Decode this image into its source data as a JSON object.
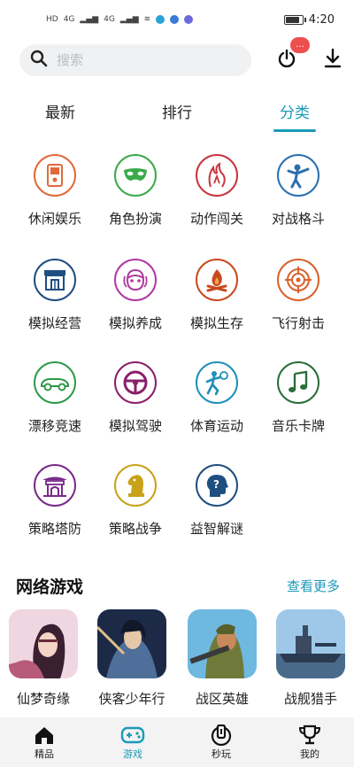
{
  "status": {
    "sim_labels": [
      "HD",
      "4G",
      "4G"
    ],
    "time": "4:20",
    "battery_level": 0.9
  },
  "search": {
    "placeholder": "搜索",
    "badge_text": "..."
  },
  "tabs": [
    {
      "label": "最新",
      "active": false
    },
    {
      "label": "排行",
      "active": false
    },
    {
      "label": "分类",
      "active": true
    }
  ],
  "categories": [
    {
      "label": "休闲娱乐",
      "icon": "handheld-console-icon",
      "color": "#e06a3a"
    },
    {
      "label": "角色扮演",
      "icon": "mask-icon",
      "color": "#3aaa4a"
    },
    {
      "label": "动作闯关",
      "icon": "flame-figure-icon",
      "color": "#c93540"
    },
    {
      "label": "对战格斗",
      "icon": "kick-fighter-icon",
      "color": "#2b6fb0"
    },
    {
      "label": "模拟经营",
      "icon": "storefront-icon",
      "color": "#1f4f80"
    },
    {
      "label": "模拟养成",
      "icon": "anime-girl-icon",
      "color": "#b03aa0"
    },
    {
      "label": "模拟生存",
      "icon": "campfire-icon",
      "color": "#c84a1f"
    },
    {
      "label": "飞行射击",
      "icon": "crosshair-target-icon",
      "color": "#d9622a"
    },
    {
      "label": "漂移竞速",
      "icon": "race-car-icon",
      "color": "#2e9a4a"
    },
    {
      "label": "模拟驾驶",
      "icon": "steering-wheel-icon",
      "color": "#8a1f6a"
    },
    {
      "label": "体育运动",
      "icon": "tennis-player-icon",
      "color": "#1e8fb8"
    },
    {
      "label": "音乐卡牌",
      "icon": "music-note-icon",
      "color": "#2a6e3a"
    },
    {
      "label": "策略塔防",
      "icon": "temple-icon",
      "color": "#7a2a8a"
    },
    {
      "label": "策略战争",
      "icon": "chess-knight-icon",
      "color": "#c9a21a"
    },
    {
      "label": "益智解谜",
      "icon": "puzzle-head-icon",
      "color": "#1f4f80"
    }
  ],
  "online_section": {
    "title": "网络游戏",
    "more": "查看更多"
  },
  "games": [
    {
      "name": "仙梦奇缘",
      "colors": [
        "#f0d6e0",
        "#b85a7a",
        "#3a2030"
      ]
    },
    {
      "name": "侠客少年行",
      "colors": [
        "#1c2a48",
        "#4f6f9a",
        "#e0c08a"
      ]
    },
    {
      "name": "战区英雄",
      "colors": [
        "#6fb8e0",
        "#6f7a3a",
        "#c88a5a"
      ]
    },
    {
      "name": "战舰猎手",
      "colors": [
        "#9fc8e8",
        "#4a6a8a",
        "#2a3a50"
      ]
    }
  ],
  "bottom_nav": [
    {
      "label": "精品",
      "icon": "home-icon",
      "active": false
    },
    {
      "label": "游戏",
      "icon": "gamepad-icon",
      "active": true
    },
    {
      "label": "秒玩",
      "icon": "instant-play-icon",
      "active": false
    },
    {
      "label": "我的",
      "icon": "trophy-icon",
      "active": false
    }
  ],
  "colors": {
    "accent": "#1a9ab8",
    "badge": "#ee4e4e"
  }
}
